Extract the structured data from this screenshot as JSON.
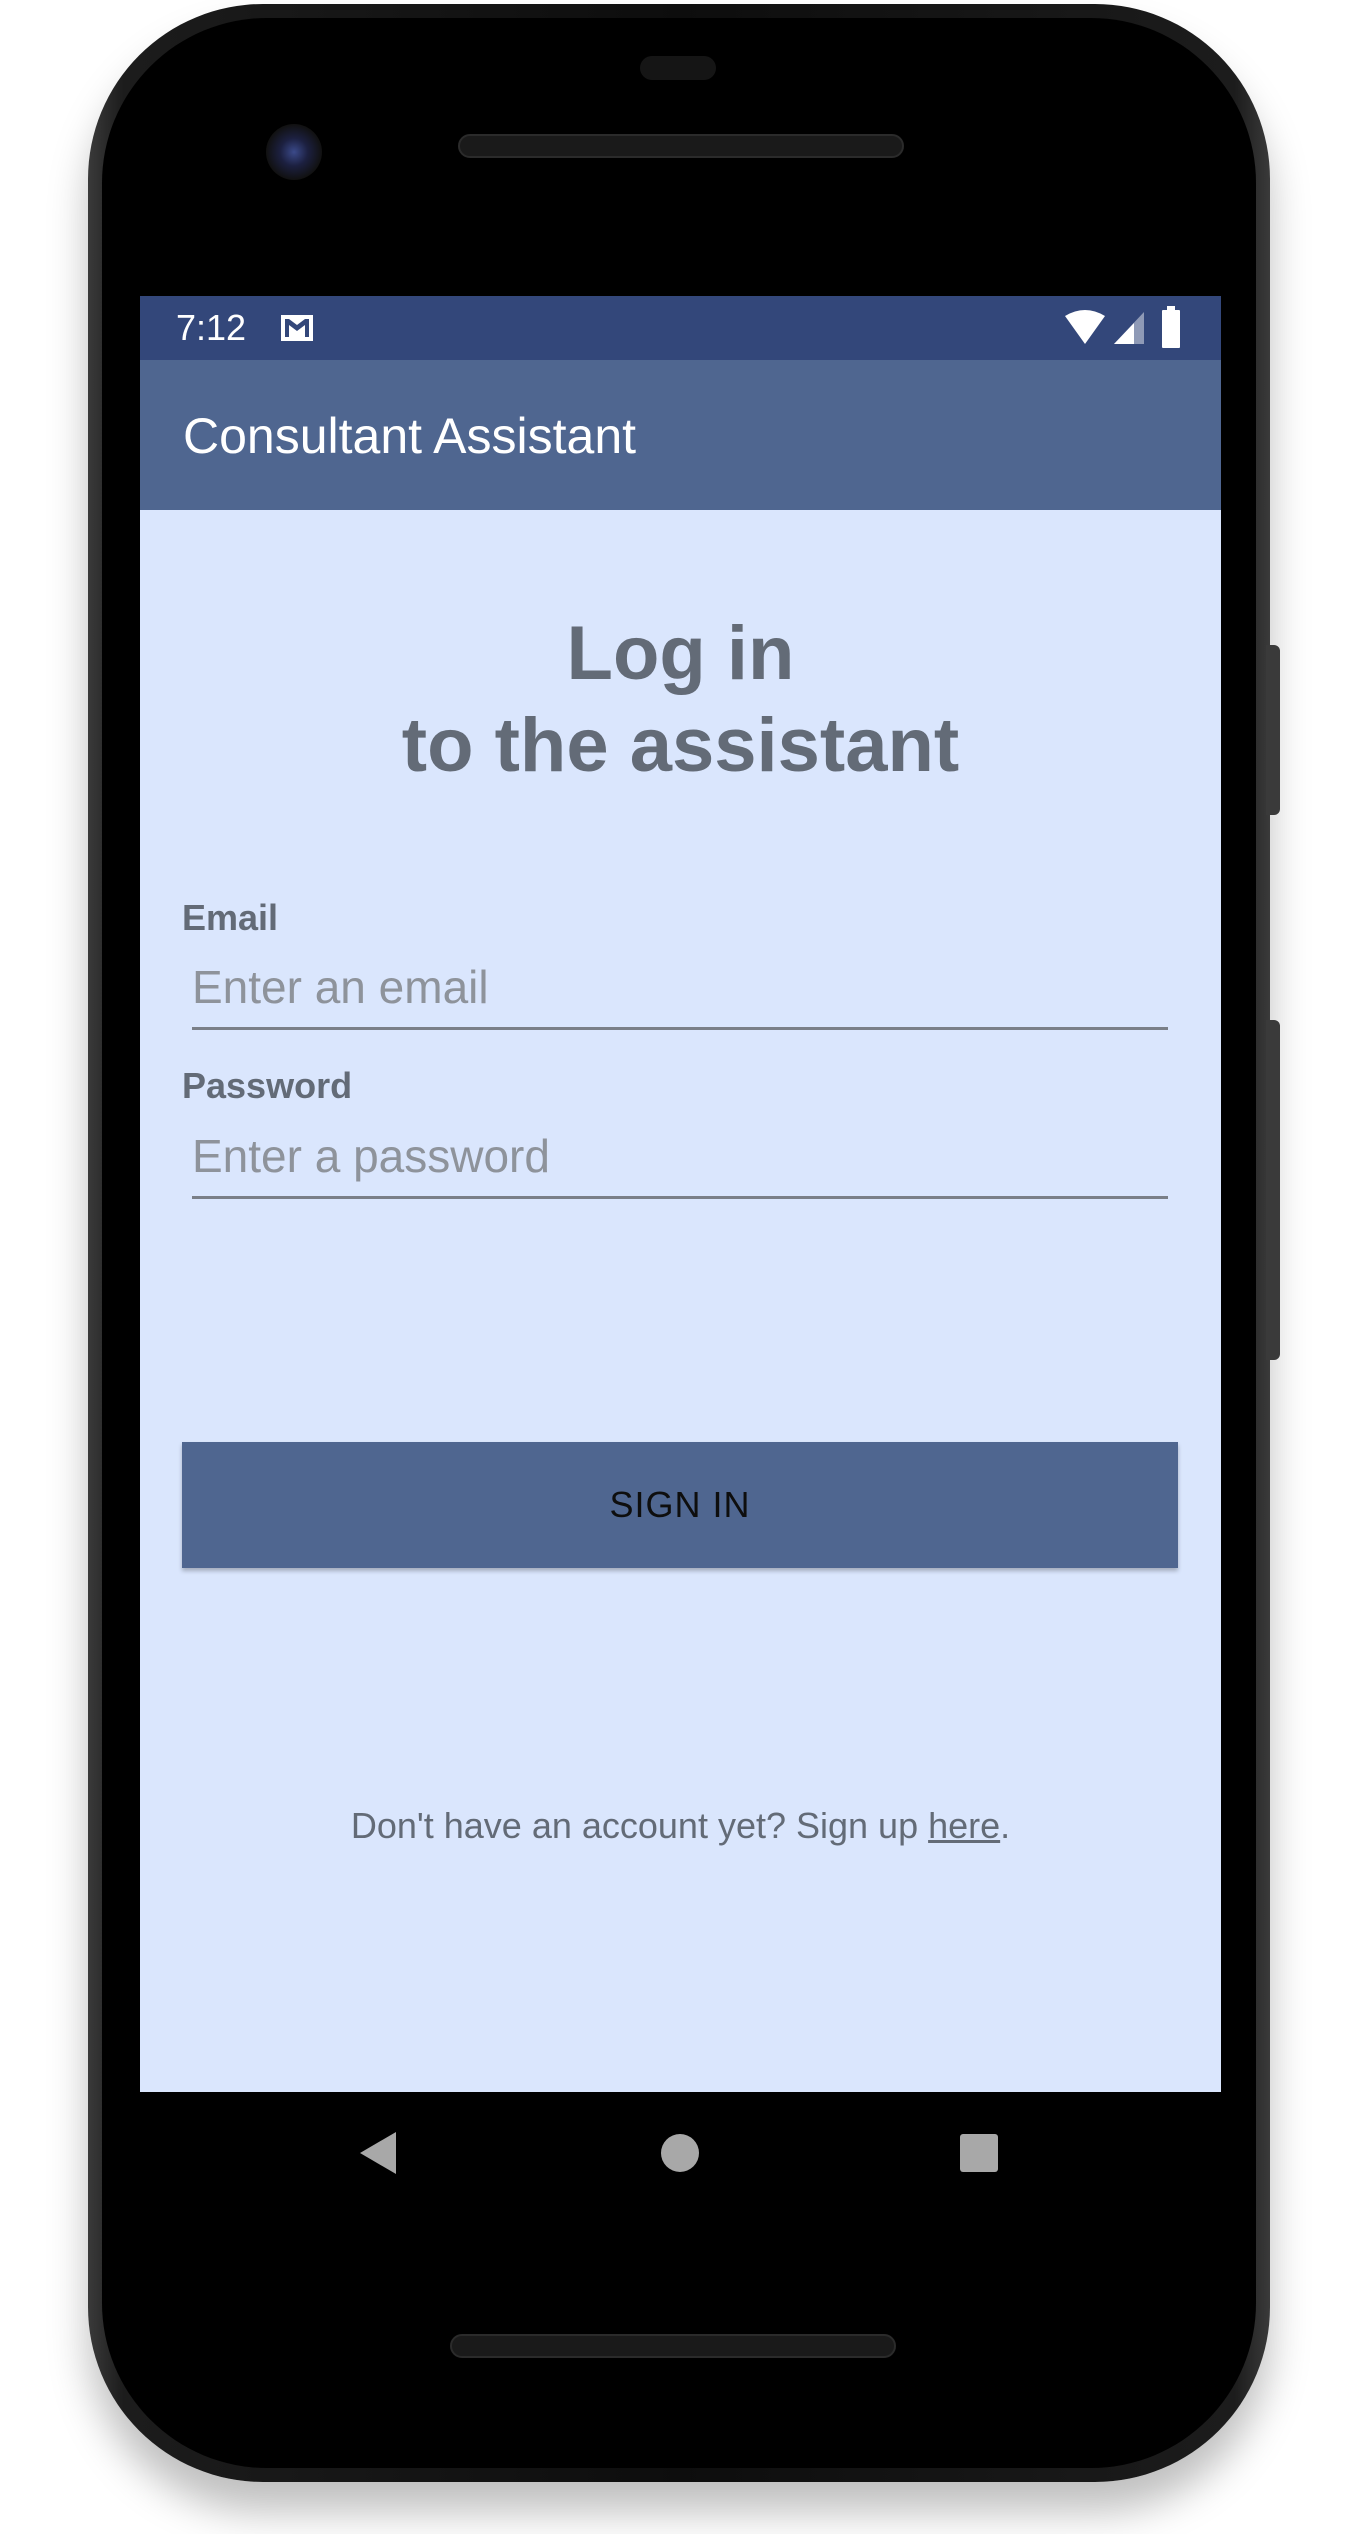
{
  "status_bar": {
    "time": "7:12"
  },
  "icons": {
    "notification": "gmail-icon",
    "wifi": "wifi-icon",
    "signal": "cell-signal-icon",
    "battery": "battery-icon"
  },
  "app_bar": {
    "title": "Consultant Assistant"
  },
  "login": {
    "heading_line1": "Log in",
    "heading_line2": "to the assistant",
    "email_label": "Email",
    "email_placeholder": "Enter an email",
    "email_value": "",
    "password_label": "Password",
    "password_placeholder": "Enter a password",
    "password_value": "",
    "sign_in_label": "SIGN IN",
    "signup_prefix": "Don't have an account yet? Sign up ",
    "signup_link": "here",
    "signup_suffix": "."
  },
  "nav_bar": {
    "back": "back-triangle-icon",
    "home": "home-circle-icon",
    "recents": "recents-square-icon"
  },
  "colors": {
    "status_bar": "#33477a",
    "app_bar": "#4f6690",
    "background": "#dae6fd",
    "text": "#636b77",
    "button": "#4f6690"
  }
}
